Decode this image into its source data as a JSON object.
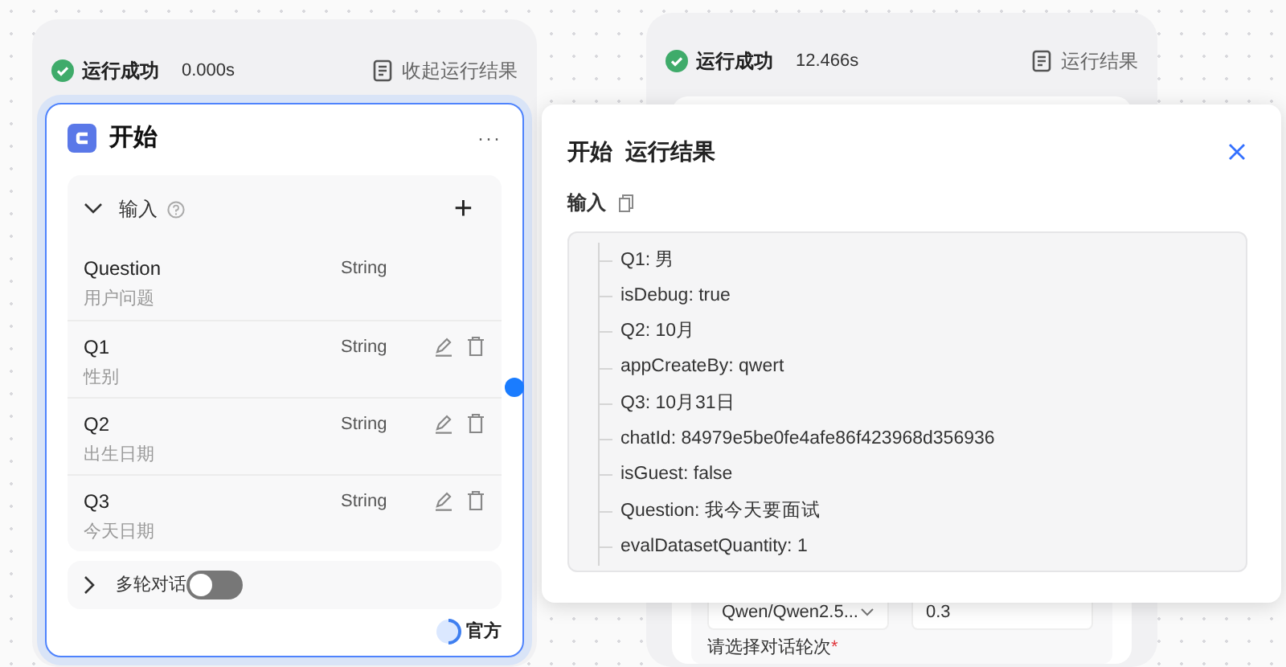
{
  "start_node": {
    "status": {
      "label": "运行成功",
      "time": "0.000s",
      "action": "收起运行结果"
    },
    "title": "开始",
    "more": "···",
    "inputs": {
      "label": "输入",
      "expanded": true,
      "add": "+",
      "fields": [
        {
          "name": "Question",
          "desc": "用户问题",
          "type": "String",
          "editable": false
        },
        {
          "name": "Q1",
          "desc": "性别",
          "type": "String",
          "editable": true
        },
        {
          "name": "Q2",
          "desc": "出生日期",
          "type": "String",
          "editable": true
        },
        {
          "name": "Q3",
          "desc": "今天日期",
          "type": "String",
          "editable": true
        }
      ]
    },
    "multi_turn": {
      "label": "多轮对话",
      "expanded": false,
      "on": false
    },
    "badge": "官方"
  },
  "second_node": {
    "status": {
      "label": "运行成功",
      "time": "12.466s",
      "action": "运行结果"
    },
    "model": "Qwen/Qwen2.5...",
    "temperature": "0.3",
    "turns_label": "请选择对话轮次",
    "required": "*"
  },
  "result_popup": {
    "title": "开始  运行结果",
    "section": "输入",
    "items": [
      "Q1: 男",
      "isDebug: true",
      "Q2: 10月",
      "appCreateBy: qwert",
      "Q3: 10月31日",
      "chatId: 84979e5be0fe4afe86f423968d356936",
      "isGuest: false",
      "Question: 我今天要面试",
      "evalDatasetQuantity: 1"
    ]
  }
}
